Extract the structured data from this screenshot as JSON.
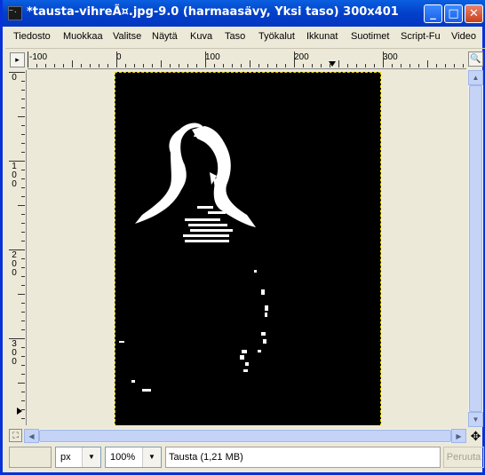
{
  "window": {
    "title": "*tausta-vihreÃ¤.jpg-9.0 (harmaasävy, Yksi taso) 300x401",
    "icon": "gimp-image-icon",
    "controls": [
      "minimize",
      "maximize",
      "close"
    ]
  },
  "menu": [
    "Tiedosto",
    "Muokkaa",
    "Valitse",
    "Näytä",
    "Kuva",
    "Taso",
    "Työkalut",
    "Ikkunat",
    "Suotimet",
    "Script-Fu",
    "Video"
  ],
  "ruler": {
    "horizontal_labels": [
      "-100",
      "0",
      "100",
      "200",
      "300"
    ],
    "vertical_labels": [
      "0",
      "100",
      "200",
      "300"
    ]
  },
  "statusbar": {
    "unit": "px",
    "zoom": "100%",
    "message": "Tausta (1,21 MB)",
    "cancel_label": "Peruuta"
  },
  "colors": {
    "titlebar": "#0a5fe0",
    "canvas_bg": "#ece9d8",
    "image_bg": "#000000",
    "selection": "#e8d400"
  }
}
